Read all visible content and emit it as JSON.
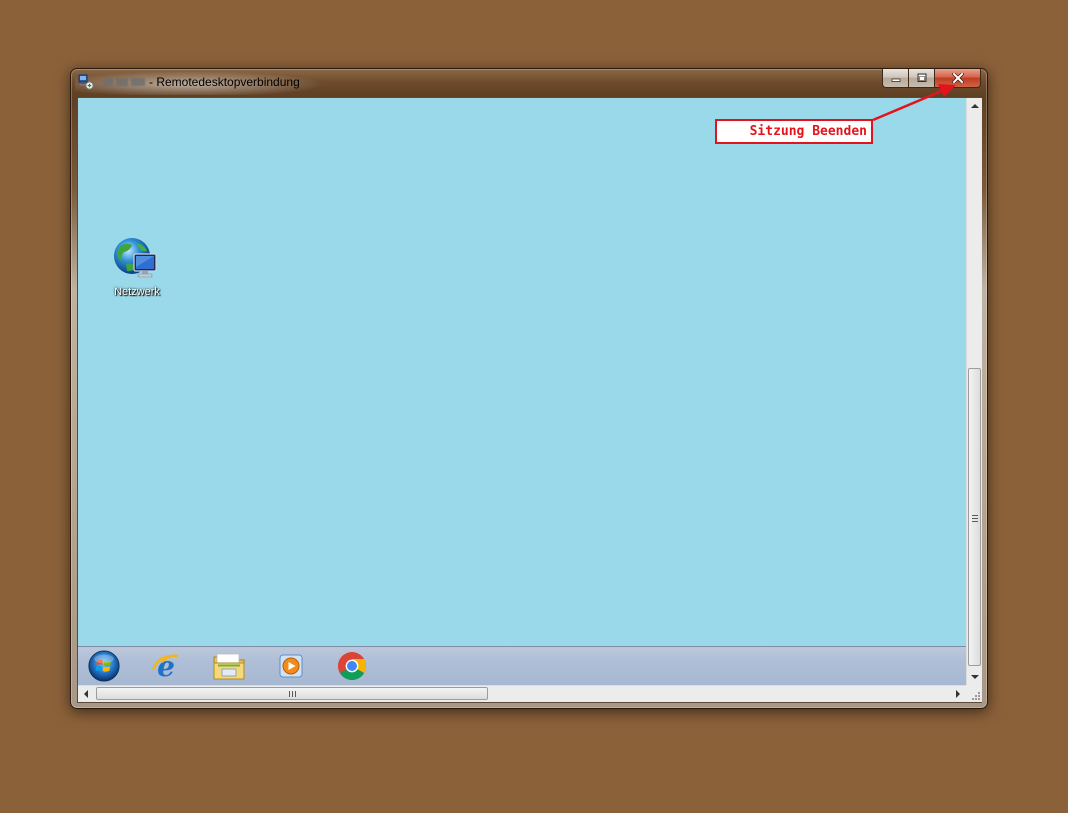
{
  "window": {
    "title_suffix": "- Remotedesktopverbindung",
    "caption_buttons": {
      "minimize": "minimize-icon",
      "maximize": "maximize-icon",
      "close": "close-icon"
    }
  },
  "desktop": {
    "background_color": "#99d9ea",
    "icons": [
      {
        "label": "Netzwerk",
        "icon": "network-globe-icon"
      }
    ]
  },
  "taskbar": {
    "items": [
      {
        "icon": "windows-start-orb-icon"
      },
      {
        "icon": "internet-explorer-icon"
      },
      {
        "icon": "windows-explorer-folder-icon"
      },
      {
        "icon": "windows-media-player-icon"
      },
      {
        "icon": "google-chrome-icon"
      }
    ]
  },
  "annotation": {
    "label": "Sitzung Beenden",
    "color": "#e4131b"
  }
}
